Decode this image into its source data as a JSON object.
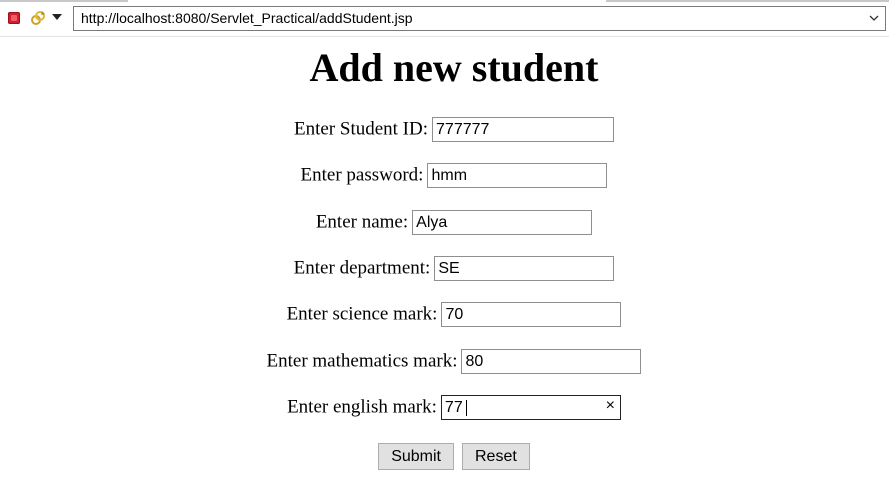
{
  "browser": {
    "url": "http://localhost:8080/Servlet_Practical/addStudent.jsp",
    "icons": [
      "stop-icon",
      "refresh-icon",
      "menu-dropdown-icon",
      "url-dropdown-icon"
    ]
  },
  "page": {
    "title": "Add new student"
  },
  "form": {
    "fields": [
      {
        "label": "Enter Student ID:",
        "value": "777777"
      },
      {
        "label": "Enter password:",
        "value": "hmm"
      },
      {
        "label": "Enter name:",
        "value": "Alya"
      },
      {
        "label": "Enter department:",
        "value": "SE"
      },
      {
        "label": "Enter science mark:",
        "value": "70"
      },
      {
        "label": "Enter mathematics mark:",
        "value": "80"
      },
      {
        "label": "Enter english mark:",
        "value": "77",
        "clear_symbol": "×"
      }
    ],
    "submit_label": "Submit",
    "reset_label": "Reset"
  }
}
